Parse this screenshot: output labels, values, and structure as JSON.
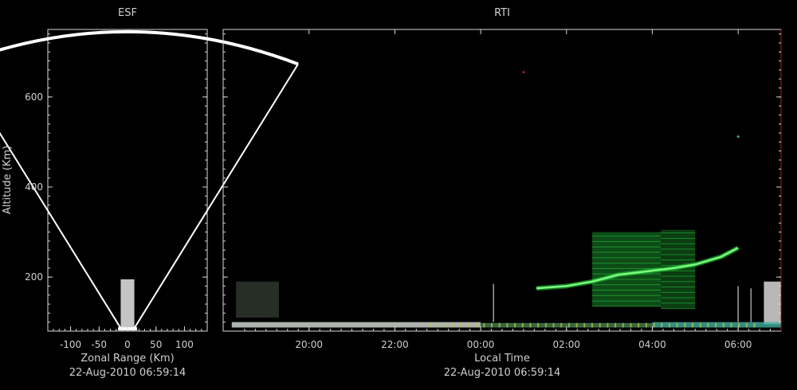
{
  "chart_data": [
    {
      "type": "heatmap",
      "title": "ESF",
      "xlabel": "Zonal Range (Km)",
      "ylabel": "Altitude (Km)",
      "timestamp": "22-Aug-2010 06:59:14",
      "xlim": [
        -140,
        140
      ],
      "ylim": [
        80,
        750
      ],
      "xticks": [
        -100,
        -50,
        0,
        50,
        100
      ],
      "xtick_labels": [
        "-100",
        "-50",
        "0",
        "50",
        "100"
      ],
      "yticks": [
        200,
        400,
        600
      ],
      "ytick_labels": [
        "200",
        "400",
        "600"
      ],
      "colors": {
        "background": "#000000",
        "frame": "#ffffff",
        "echo": "#e8e8e8"
      },
      "fan": {
        "apex_altitude": 85,
        "half_angle_deg": 27,
        "max_range_km": 660
      },
      "echoes": [
        {
          "x": [
            -12,
            12
          ],
          "y": [
            85,
            195
          ],
          "intensity": 0.85
        }
      ]
    },
    {
      "type": "heatmap",
      "title": "RTI",
      "xlabel": "Local Time",
      "timestamp": "22-Aug-2010 06:59:14",
      "xlim": [
        18.0,
        31.0
      ],
      "ylim": [
        80,
        750
      ],
      "xticks": [
        20,
        22,
        24,
        26,
        28,
        30
      ],
      "xtick_labels": [
        "20:00",
        "22:00",
        "00:00",
        "02:00",
        "04:00",
        "06:00"
      ],
      "yticks": [
        200,
        400,
        600
      ],
      "colors": {
        "background": "#000000",
        "frame": "#ffffff",
        "echo_primary": "#22c83c",
        "echo_bright": "#7dff7d",
        "echo_white": "#e6e6e6",
        "echo_teal": "#3fb0a0",
        "echo_yellow": "#c8c840",
        "edge_marker": "#b02020"
      },
      "blocks": [
        {
          "t": [
            18.3,
            19.3
          ],
          "alt": [
            110,
            190
          ],
          "color": "#556655",
          "opacity": 0.45
        },
        {
          "t": [
            26.6,
            28.2
          ],
          "alt": [
            135,
            300
          ],
          "color": "#1a8a2a",
          "opacity": 0.55
        },
        {
          "t": [
            28.2,
            29.0
          ],
          "alt": [
            130,
            305
          ],
          "color": "#157a22",
          "opacity": 0.5
        },
        {
          "t": [
            30.6,
            31.0
          ],
          "alt": [
            95,
            190
          ],
          "color": "#d8d8d8",
          "opacity": 0.85
        }
      ],
      "bottom_layer": [
        {
          "t": [
            18.2,
            24.0
          ],
          "alt": [
            88,
            100
          ],
          "color": "#d8e0d8",
          "opacity": 0.8
        },
        {
          "t": [
            24.0,
            28.0
          ],
          "alt": [
            88,
            98
          ],
          "color": "#4a8a5a",
          "opacity": 0.75
        },
        {
          "t": [
            28.0,
            31.0
          ],
          "alt": [
            88,
            100
          ],
          "color": "#3fb0a0",
          "opacity": 0.8
        }
      ],
      "traces": [
        {
          "points": [
            [
              25.3,
              175
            ],
            [
              26.0,
              180
            ],
            [
              26.6,
              190
            ],
            [
              27.2,
              205
            ],
            [
              27.8,
              212
            ],
            [
              28.5,
              220
            ],
            [
              29.0,
              228
            ],
            [
              29.6,
              245
            ],
            [
              30.0,
              265
            ]
          ],
          "color": "#22c83c",
          "bright": "#7dff7d"
        }
      ],
      "spikes": [
        {
          "t": 24.3,
          "alt": [
            100,
            185
          ]
        },
        {
          "t": 30.0,
          "alt": [
            100,
            180
          ]
        },
        {
          "t": 30.3,
          "alt": [
            100,
            175
          ]
        }
      ],
      "dots": [
        {
          "t": 25.0,
          "alt": 655,
          "color": "#b02020"
        },
        {
          "t": 30.0,
          "alt": 512,
          "color": "#3fb0a0"
        }
      ]
    }
  ]
}
